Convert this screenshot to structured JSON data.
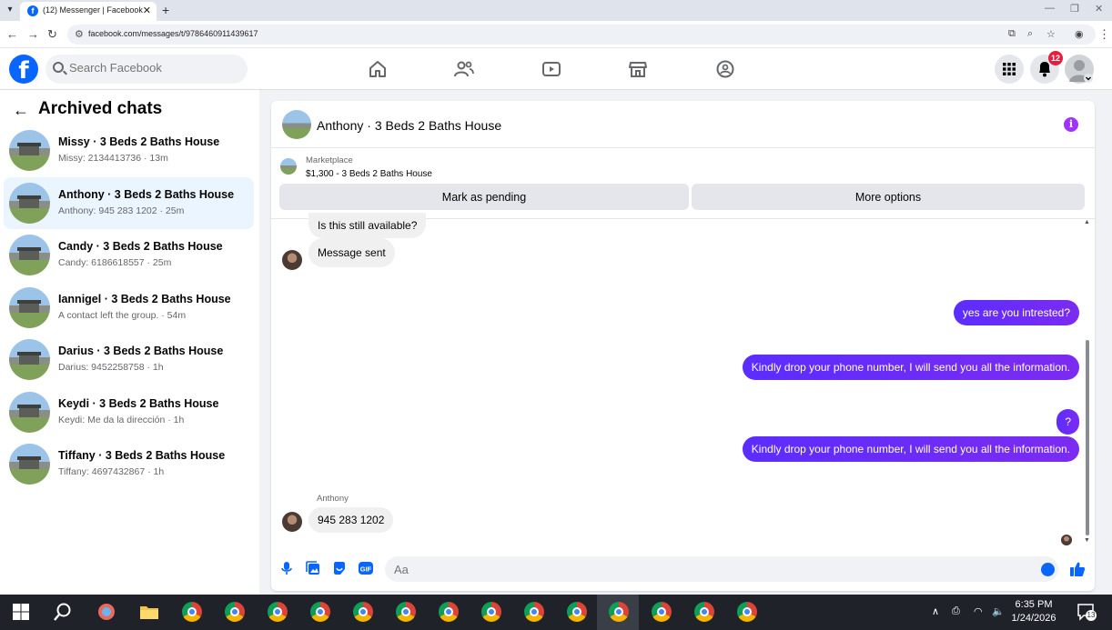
{
  "browser": {
    "tab_title": "(12) Messenger | Facebook",
    "url": "facebook.com/messages/t/9786460911439617"
  },
  "header": {
    "search_placeholder": "Search Facebook",
    "notifications_count": "12"
  },
  "sidebar": {
    "title": "Archived chats",
    "chats": [
      {
        "name": "Missy · 3 Beds 2 Baths House",
        "preview": "Missy: 2134413736 · 13m"
      },
      {
        "name": "Anthony · 3 Beds 2 Baths House",
        "preview": "Anthony: 945 283 1202 · 25m",
        "active": true
      },
      {
        "name": "Candy · 3 Beds 2 Baths House",
        "preview": "Candy: 6186618557 · 25m"
      },
      {
        "name": "Iannigel · 3 Beds 2 Baths House",
        "preview": "A contact left the group. · 54m"
      },
      {
        "name": "Darius · 3 Beds 2 Baths House",
        "preview": "Darius: 9452258758 · 1h"
      },
      {
        "name": "Keydi · 3 Beds 2 Baths House",
        "preview": "Keydi: Me da la dirección · 1h"
      },
      {
        "name": "Tiffany · 3 Beds 2 Baths House",
        "preview": "Tiffany: 4697432867 · 1h"
      }
    ]
  },
  "conversation": {
    "title": "Anthony · 3 Beds 2 Baths House",
    "marketplace_label": "Marketplace",
    "listing": "$1,300 - 3 Beds 2 Baths House",
    "mark_pending": "Mark as pending",
    "more_options": "More options",
    "messages": {
      "m1": "Is this still available?",
      "m2": "Message sent",
      "m3": "yes are you intrested?",
      "m4": "Kindly drop your phone number, I will send you all the information.",
      "m5": "?",
      "m6": "Kindly drop your phone number, I will send you all the information.",
      "sender": "Anthony",
      "m7": "945 283 1202"
    },
    "composer_placeholder": "Aa"
  },
  "taskbar": {
    "time": "6:35 PM",
    "date": "1/24/2026",
    "notif_count": "13"
  },
  "colors": {
    "brand": "#0866ff",
    "outgoing_bubble": "#6b34ff",
    "info": "#a033ff"
  }
}
